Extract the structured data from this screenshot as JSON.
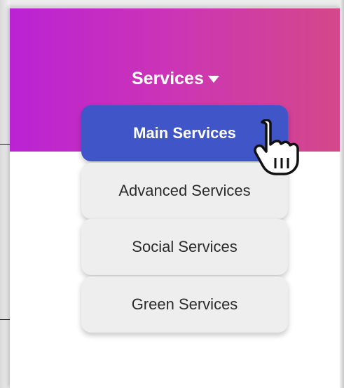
{
  "nav": {
    "toggle_label": "Services",
    "toggle_icon": "caret-down-icon"
  },
  "menu": {
    "items": [
      {
        "label": "Main Services",
        "active": true
      },
      {
        "label": "Advanced Services",
        "active": false
      },
      {
        "label": "Social Services",
        "active": false
      },
      {
        "label": "Green Services",
        "active": false
      }
    ]
  },
  "cursor": {
    "icon": "hand-pointer-icon"
  },
  "colors": {
    "header_gradient_start": "#bb22d4",
    "header_gradient_end": "#d4488a",
    "active_item": "#3f55c8",
    "inactive_item": "#eeeeee",
    "item_text": "#2b2b2b"
  }
}
